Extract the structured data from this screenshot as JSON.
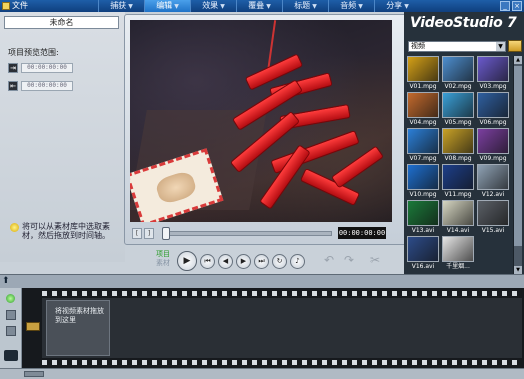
{
  "menu": {
    "file": "文件"
  },
  "steps": [
    {
      "label": "捕获",
      "active": false
    },
    {
      "label": "编辑",
      "active": true
    },
    {
      "label": "效果",
      "active": false
    },
    {
      "label": "覆叠",
      "active": false
    },
    {
      "label": "标题",
      "active": false
    },
    {
      "label": "音频",
      "active": false
    },
    {
      "label": "分享",
      "active": false
    }
  ],
  "project": {
    "name": "未命名",
    "range_label": "项目预览范围:",
    "start_time": "00:00:00:00",
    "end_time": "00:00:00:00"
  },
  "hint": "将可以从素材库中选取素材，然后拖放到时间轴。",
  "preview": {
    "timecode": "00:00:00:00",
    "mode_project": "项目",
    "mode_clip": "素材",
    "progress": 0.02
  },
  "library": {
    "app_name": "VideoStudio 7",
    "category": "视频",
    "items": [
      {
        "label": "V01.mpg",
        "color": "#d4a017"
      },
      {
        "label": "V02.mpg",
        "color": "#4d8ecf"
      },
      {
        "label": "V03.mpg",
        "color": "#6a5acd"
      },
      {
        "label": "V04.mpg",
        "color": "#c36a2d"
      },
      {
        "label": "V05.mpg",
        "color": "#3aa0d8"
      },
      {
        "label": "V06.mpg",
        "color": "#2f5fa0"
      },
      {
        "label": "V07.mpg",
        "color": "#2b7fd8"
      },
      {
        "label": "V08.mpg",
        "color": "#c9a227"
      },
      {
        "label": "V09.mpg",
        "color": "#7b3fa0"
      },
      {
        "label": "V10.mpg",
        "color": "#1e6fd0"
      },
      {
        "label": "V11.mpg",
        "color": "#1d3f8a"
      },
      {
        "label": "V12.avi",
        "color": "#8fa2b5"
      },
      {
        "label": "V13.avi",
        "color": "#1b7a3a"
      },
      {
        "label": "V14.avi",
        "color": "#d6d6c2"
      },
      {
        "label": "V15.avi",
        "color": "#5a5f66"
      },
      {
        "label": "V16.avi",
        "color": "#2d4c8a"
      },
      {
        "label": "千里烟...",
        "color": "#e6e6e6"
      }
    ]
  },
  "timeline": {
    "placeholder": "将视频素材拖放到这里"
  },
  "colors": {
    "accent": "#1f72c7",
    "library_bg": "#26313b",
    "play_indicator": "#2a9d2a"
  }
}
